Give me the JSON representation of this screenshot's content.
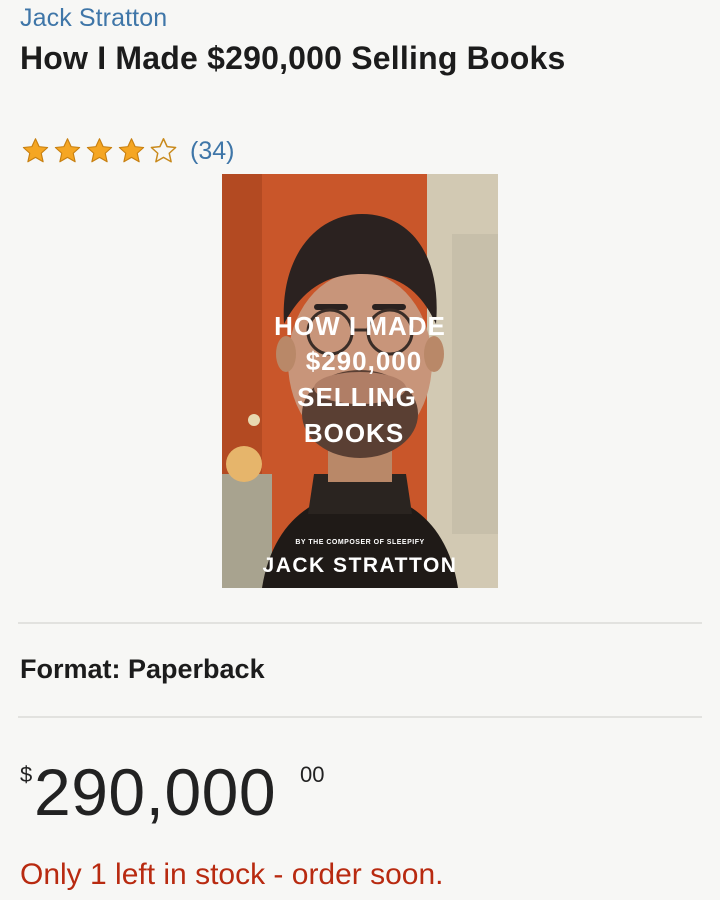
{
  "product": {
    "author": "Jack Stratton",
    "title": "How I Made $290,000 Selling Books",
    "rating": {
      "stars": 4,
      "out_of": 5,
      "count_label": "(34)",
      "star_color": "#f5a623"
    },
    "cover": {
      "title_lines": [
        "HOW I MADE",
        "$290,000",
        "SELLING",
        "BOOKS"
      ],
      "byline": "BY THE COMPOSER OF SLEEPIFY",
      "author": "JACK STRATTON"
    },
    "format_label": "Format: Paperback",
    "price": {
      "currency": "$",
      "whole": "290,000",
      "fraction": "00"
    },
    "stock_message": "Only 1 left in stock - order soon.",
    "colors": {
      "link": "#3f76a8",
      "stock": "#b82a10",
      "text": "#1c1c1c"
    }
  }
}
